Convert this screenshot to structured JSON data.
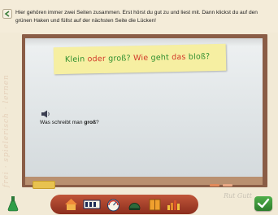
{
  "instruction": "Hier gehören immer zwei Seiten zusammen. Erst hörst du gut zu und liest mit. Dann klickst du auf den grünen Haken und füllst auf der nächsten Seite die Lücken!",
  "note": {
    "segments": [
      {
        "text": "Klein",
        "color": "#2f8f2f"
      },
      {
        "text": " ",
        "color": "#2f8f2f"
      },
      {
        "text": "oder",
        "color": "#d23a2a"
      },
      {
        "text": " ",
        "color": "#2f8f2f"
      },
      {
        "text": "groß?",
        "color": "#2f8f2f"
      },
      {
        "text": " ",
        "color": "#2f8f2f"
      },
      {
        "text": "Wie",
        "color": "#d23a2a"
      },
      {
        "text": " ",
        "color": "#2f8f2f"
      },
      {
        "text": "geht",
        "color": "#2f8f2f"
      },
      {
        "text": " ",
        "color": "#2f8f2f"
      },
      {
        "text": "das",
        "color": "#d23a2a"
      },
      {
        "text": " ",
        "color": "#2f8f2f"
      },
      {
        "text": "bloß?",
        "color": "#2f8f2f"
      }
    ]
  },
  "question": {
    "prefix": "Was schreibt man ",
    "bold": "groß",
    "suffix": "?"
  },
  "colors": {
    "board_frame": "#8a5d46",
    "note_bg": "#f6efa2",
    "accent_green": "#3e9b3a",
    "toolbar_red": "#a53e26"
  },
  "icons": [
    "back-arrow-icon",
    "speaker-icon",
    "flask-icon",
    "home-icon",
    "film-icon",
    "speedometer-icon",
    "dome-icon",
    "book-icon",
    "bars-chart-icon",
    "checkmark-icon"
  ]
}
